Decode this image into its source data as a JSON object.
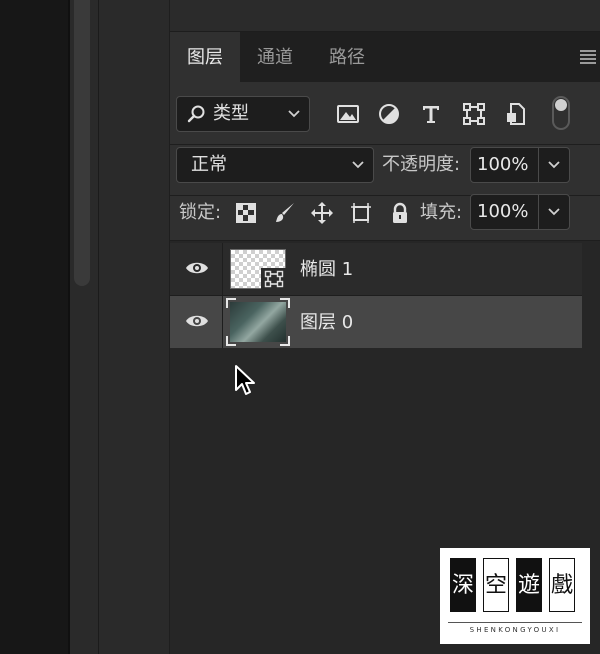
{
  "layers_panel": {
    "tabs": [
      {
        "label": "图层",
        "active": true
      },
      {
        "label": "通道",
        "active": false
      },
      {
        "label": "路径",
        "active": false
      }
    ],
    "filter": {
      "kind_label": "类型",
      "icons": [
        "image-filter-icon",
        "adjustment-filter-icon",
        "type-filter-icon",
        "shape-filter-icon",
        "smart-object-filter-icon"
      ],
      "toggle_on": true
    },
    "blend_mode": "正常",
    "opacity_label": "不透明度:",
    "opacity_value": "100%",
    "lock_label": "锁定:",
    "lock_icons": [
      "lock-transparent-pixels-icon",
      "lock-image-pixels-icon",
      "lock-position-icon",
      "lock-artboard-icon",
      "lock-all-icon"
    ],
    "fill_label": "填充:",
    "fill_value": "100%",
    "layers": [
      {
        "name": "椭圆 1",
        "visible": true,
        "selected": false,
        "kind": "shape"
      },
      {
        "name": "图层 0",
        "visible": true,
        "selected": true,
        "kind": "pixel"
      }
    ]
  },
  "watermark": {
    "chars": [
      "深",
      "空",
      "遊",
      "戲"
    ],
    "subtitle": "SHENKONGYOUXI"
  },
  "colors": {
    "panel_bg": "#262626",
    "row_bg": "#303030",
    "selected_row": "#474747",
    "text": "#e8e8e8"
  }
}
